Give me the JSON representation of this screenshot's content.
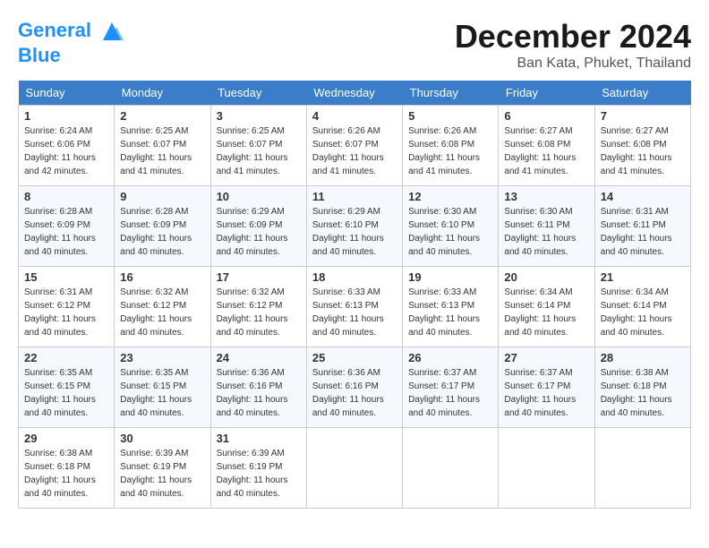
{
  "header": {
    "logo_line1": "General",
    "logo_line2": "Blue",
    "month_title": "December 2024",
    "location": "Ban Kata, Phuket, Thailand"
  },
  "weekdays": [
    "Sunday",
    "Monday",
    "Tuesday",
    "Wednesday",
    "Thursday",
    "Friday",
    "Saturday"
  ],
  "weeks": [
    [
      {
        "day": "1",
        "sunrise": "6:24 AM",
        "sunset": "6:06 PM",
        "daylight": "11 hours and 42 minutes."
      },
      {
        "day": "2",
        "sunrise": "6:25 AM",
        "sunset": "6:07 PM",
        "daylight": "11 hours and 41 minutes."
      },
      {
        "day": "3",
        "sunrise": "6:25 AM",
        "sunset": "6:07 PM",
        "daylight": "11 hours and 41 minutes."
      },
      {
        "day": "4",
        "sunrise": "6:26 AM",
        "sunset": "6:07 PM",
        "daylight": "11 hours and 41 minutes."
      },
      {
        "day": "5",
        "sunrise": "6:26 AM",
        "sunset": "6:08 PM",
        "daylight": "11 hours and 41 minutes."
      },
      {
        "day": "6",
        "sunrise": "6:27 AM",
        "sunset": "6:08 PM",
        "daylight": "11 hours and 41 minutes."
      },
      {
        "day": "7",
        "sunrise": "6:27 AM",
        "sunset": "6:08 PM",
        "daylight": "11 hours and 41 minutes."
      }
    ],
    [
      {
        "day": "8",
        "sunrise": "6:28 AM",
        "sunset": "6:09 PM",
        "daylight": "11 hours and 40 minutes."
      },
      {
        "day": "9",
        "sunrise": "6:28 AM",
        "sunset": "6:09 PM",
        "daylight": "11 hours and 40 minutes."
      },
      {
        "day": "10",
        "sunrise": "6:29 AM",
        "sunset": "6:09 PM",
        "daylight": "11 hours and 40 minutes."
      },
      {
        "day": "11",
        "sunrise": "6:29 AM",
        "sunset": "6:10 PM",
        "daylight": "11 hours and 40 minutes."
      },
      {
        "day": "12",
        "sunrise": "6:30 AM",
        "sunset": "6:10 PM",
        "daylight": "11 hours and 40 minutes."
      },
      {
        "day": "13",
        "sunrise": "6:30 AM",
        "sunset": "6:11 PM",
        "daylight": "11 hours and 40 minutes."
      },
      {
        "day": "14",
        "sunrise": "6:31 AM",
        "sunset": "6:11 PM",
        "daylight": "11 hours and 40 minutes."
      }
    ],
    [
      {
        "day": "15",
        "sunrise": "6:31 AM",
        "sunset": "6:12 PM",
        "daylight": "11 hours and 40 minutes."
      },
      {
        "day": "16",
        "sunrise": "6:32 AM",
        "sunset": "6:12 PM",
        "daylight": "11 hours and 40 minutes."
      },
      {
        "day": "17",
        "sunrise": "6:32 AM",
        "sunset": "6:12 PM",
        "daylight": "11 hours and 40 minutes."
      },
      {
        "day": "18",
        "sunrise": "6:33 AM",
        "sunset": "6:13 PM",
        "daylight": "11 hours and 40 minutes."
      },
      {
        "day": "19",
        "sunrise": "6:33 AM",
        "sunset": "6:13 PM",
        "daylight": "11 hours and 40 minutes."
      },
      {
        "day": "20",
        "sunrise": "6:34 AM",
        "sunset": "6:14 PM",
        "daylight": "11 hours and 40 minutes."
      },
      {
        "day": "21",
        "sunrise": "6:34 AM",
        "sunset": "6:14 PM",
        "daylight": "11 hours and 40 minutes."
      }
    ],
    [
      {
        "day": "22",
        "sunrise": "6:35 AM",
        "sunset": "6:15 PM",
        "daylight": "11 hours and 40 minutes."
      },
      {
        "day": "23",
        "sunrise": "6:35 AM",
        "sunset": "6:15 PM",
        "daylight": "11 hours and 40 minutes."
      },
      {
        "day": "24",
        "sunrise": "6:36 AM",
        "sunset": "6:16 PM",
        "daylight": "11 hours and 40 minutes."
      },
      {
        "day": "25",
        "sunrise": "6:36 AM",
        "sunset": "6:16 PM",
        "daylight": "11 hours and 40 minutes."
      },
      {
        "day": "26",
        "sunrise": "6:37 AM",
        "sunset": "6:17 PM",
        "daylight": "11 hours and 40 minutes."
      },
      {
        "day": "27",
        "sunrise": "6:37 AM",
        "sunset": "6:17 PM",
        "daylight": "11 hours and 40 minutes."
      },
      {
        "day": "28",
        "sunrise": "6:38 AM",
        "sunset": "6:18 PM",
        "daylight": "11 hours and 40 minutes."
      }
    ],
    [
      {
        "day": "29",
        "sunrise": "6:38 AM",
        "sunset": "6:18 PM",
        "daylight": "11 hours and 40 minutes."
      },
      {
        "day": "30",
        "sunrise": "6:39 AM",
        "sunset": "6:19 PM",
        "daylight": "11 hours and 40 minutes."
      },
      {
        "day": "31",
        "sunrise": "6:39 AM",
        "sunset": "6:19 PM",
        "daylight": "11 hours and 40 minutes."
      },
      null,
      null,
      null,
      null
    ]
  ],
  "labels": {
    "sunrise": "Sunrise:",
    "sunset": "Sunset:",
    "daylight": "Daylight:"
  }
}
